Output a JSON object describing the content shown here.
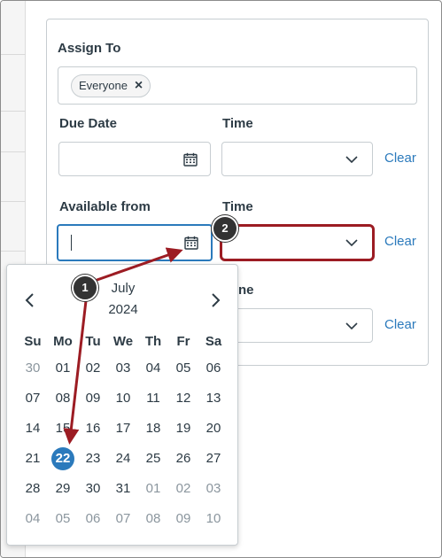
{
  "assign_to": {
    "label": "Assign To",
    "tag": "Everyone"
  },
  "due": {
    "date_label": "Due Date",
    "time_label": "Time",
    "clear": "Clear"
  },
  "available_from": {
    "date_label": "Available from",
    "time_label": "Time",
    "clear": "Clear"
  },
  "until": {
    "time_label_partial": "ne",
    "clear": "Clear"
  },
  "calendar": {
    "month": "July",
    "year": "2024",
    "weekdays": [
      "Su",
      "Mo",
      "Tu",
      "We",
      "Th",
      "Fr",
      "Sa"
    ],
    "weeks": [
      [
        "30",
        "01",
        "02",
        "03",
        "04",
        "05",
        "06"
      ],
      [
        "07",
        "08",
        "09",
        "10",
        "11",
        "12",
        "13"
      ],
      [
        "14",
        "15",
        "16",
        "17",
        "18",
        "19",
        "20"
      ],
      [
        "21",
        "22",
        "23",
        "24",
        "25",
        "26",
        "27"
      ],
      [
        "28",
        "29",
        "30",
        "31",
        "01",
        "02",
        "03"
      ],
      [
        "04",
        "05",
        "06",
        "07",
        "08",
        "09",
        "10"
      ]
    ],
    "selected": "22"
  },
  "callouts": {
    "one": "1",
    "two": "2"
  },
  "colors": {
    "accent": "#2b7abc",
    "callout_arrow": "#9c1c23",
    "badge": "#333333"
  }
}
